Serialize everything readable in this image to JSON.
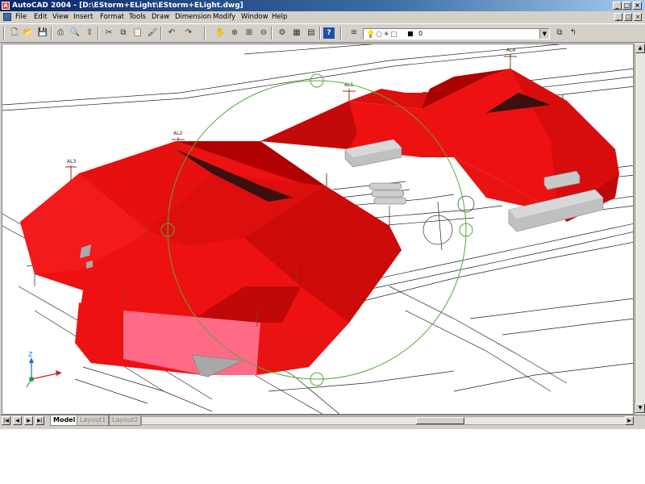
{
  "window": {
    "title": "AutoCAD 2004 - [D:\\EStorm+ELight\\EStorm+ELight.dwg]"
  },
  "menu": [
    "File",
    "Edit",
    "View",
    "Insert",
    "Format",
    "Tools",
    "Draw",
    "Dimension",
    "Modify",
    "Window",
    "Help"
  ],
  "toolbar": {
    "layer_name": "0"
  },
  "tabs": [
    "Model",
    "Layout1",
    "Layout2"
  ],
  "drawing": {
    "light_labels": [
      "AL3",
      "AL2",
      "AL1",
      "AL4"
    ],
    "ucs": {
      "z_label": "Z"
    },
    "colors": {
      "surface": "#ee1111",
      "shadow": "#b00000",
      "pink": "#ff6680",
      "orbit": "#55aa33",
      "building": "#c0c0c0"
    }
  }
}
